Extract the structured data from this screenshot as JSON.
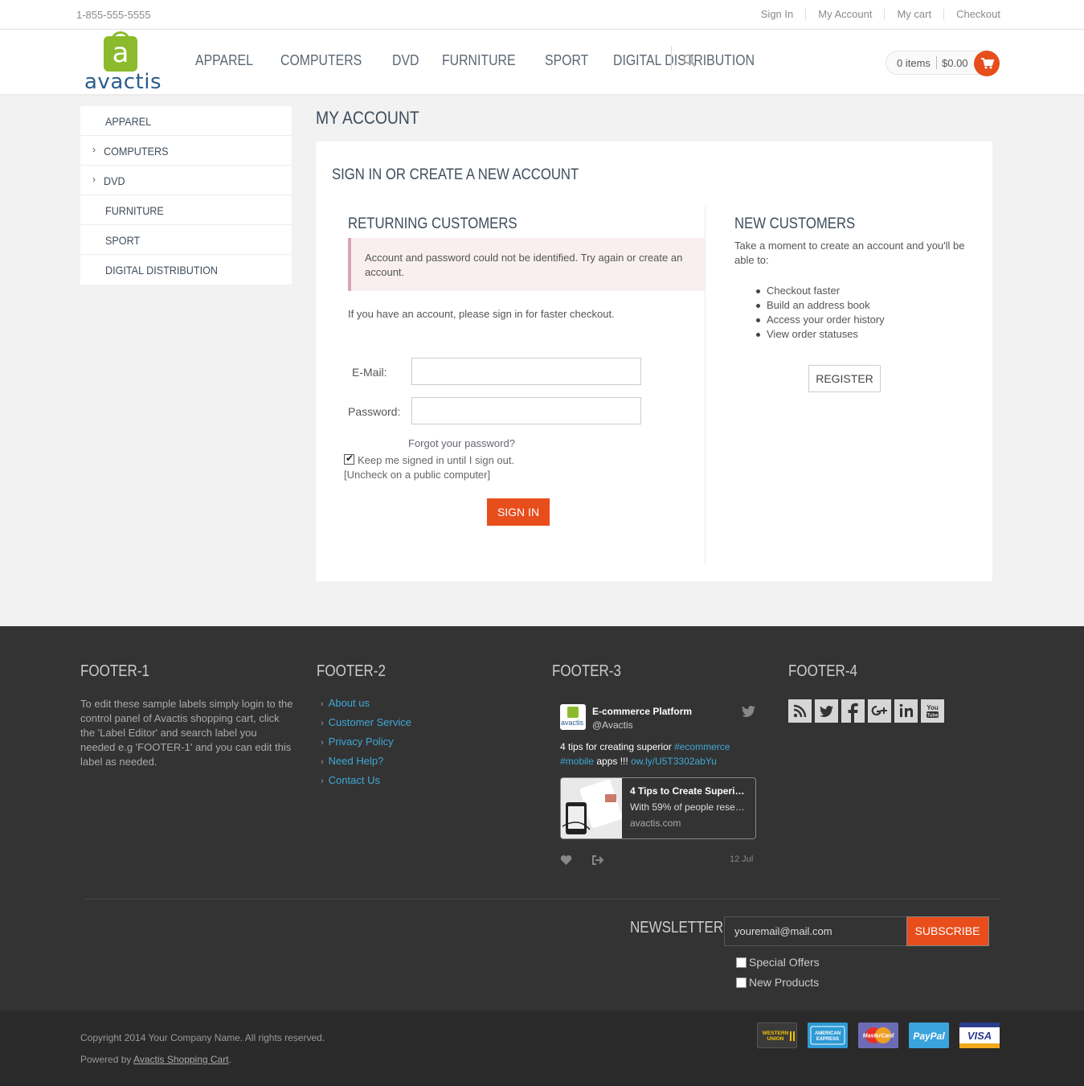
{
  "topbar": {
    "phone": "1-855-555-5555",
    "links": [
      "Sign In",
      "My Account",
      "My cart",
      "Checkout"
    ]
  },
  "logo": {
    "text": "avactis",
    "glyph": "a"
  },
  "nav": {
    "items": [
      "APPAREL",
      "COMPUTERS",
      "DVD",
      "FURNITURE",
      "SPORT",
      "DIGITAL DISTRIBUTION"
    ]
  },
  "cart": {
    "items": "0 items",
    "total": "$0.00"
  },
  "sidebar": {
    "items": [
      {
        "label": "APPAREL",
        "expandable": false
      },
      {
        "label": "COMPUTERS",
        "expandable": true
      },
      {
        "label": "DVD",
        "expandable": true
      },
      {
        "label": "FURNITURE",
        "expandable": false
      },
      {
        "label": "SPORT",
        "expandable": false
      },
      {
        "label": "DIGITAL DISTRIBUTION",
        "expandable": false
      }
    ]
  },
  "page": {
    "title": "MY ACCOUNT",
    "panel_title": "SIGN IN OR CREATE A NEW ACCOUNT"
  },
  "returning": {
    "heading": "RETURNING CUSTOMERS",
    "error": "Account and password could not be identified. Try again or create an account.",
    "help": "If you have an account, please sign in for faster checkout.",
    "email_label": "E-Mail:",
    "email_value": "",
    "password_label": "Password:",
    "password_value": "",
    "forgot": "Forgot your password?",
    "keep_signed": "Keep me signed in until I sign out.",
    "keep_checked": true,
    "uncheck_note": "[Uncheck on a public computer]",
    "signin_button": "SIGN IN"
  },
  "new_customers": {
    "heading": "NEW CUSTOMERS",
    "intro": "Take a moment to create an account and you'll be able to:",
    "benefits": [
      "Checkout faster",
      "Build an address book",
      "Access your order history",
      "View order statuses"
    ],
    "register_button": "REGISTER"
  },
  "footer": {
    "col1": {
      "heading": "FOOTER-1",
      "text": "To edit these sample labels simply login to the control panel of Avactis shopping cart, click the 'Label Editor' and search label you needed e.g 'FOOTER-1' and you can edit this label as needed."
    },
    "col2": {
      "heading": "FOOTER-2",
      "links": [
        "About us",
        "Customer Service",
        "Privacy Policy",
        "Need Help?",
        "Contact Us"
      ]
    },
    "col3": {
      "heading": "FOOTER-3",
      "tweet": {
        "name": "E-commerce Platform",
        "handle": "@Avactis",
        "avatar_text": "avactis",
        "text_1": "4 tips for creating superior ",
        "hashtag_1": "#ecommerce",
        "hashtag_2": "#mobile",
        "text_2": " apps !!! ",
        "link": "ow.ly/U5T3302abYu",
        "card_title": "4 Tips to Create Superi…",
        "card_desc": "With 59% of people rese…",
        "card_url": "avactis.com",
        "date": "12 Jul"
      }
    },
    "col4": {
      "heading": "FOOTER-4",
      "social": [
        "rss-icon",
        "twitter-icon",
        "facebook-icon",
        "google-plus-icon",
        "linkedin-icon",
        "youtube-icon"
      ]
    },
    "newsletter": {
      "label": "NEWSLETTER",
      "placeholder": "youremail@mail.com",
      "button": "SUBSCRIBE",
      "options": [
        "Special Offers",
        "New Products"
      ]
    }
  },
  "bottom": {
    "copyright": "Copyright 2014 Your Company Name. All rights reserved.",
    "powered_prefix": "Powered by ",
    "powered_link": "Avactis Shopping Cart",
    "powered_suffix": ".",
    "payments": [
      "WESTERN UNION",
      "AMERICAN EXPRESS",
      "MasterCard",
      "PayPal",
      "VISA"
    ]
  },
  "colors": {
    "accent": "#e84d1c",
    "link": "#3fa9d6",
    "logo_green": "#8bbb2c",
    "logo_blue": "#2d5d8c",
    "footer_bg": "#333333"
  }
}
